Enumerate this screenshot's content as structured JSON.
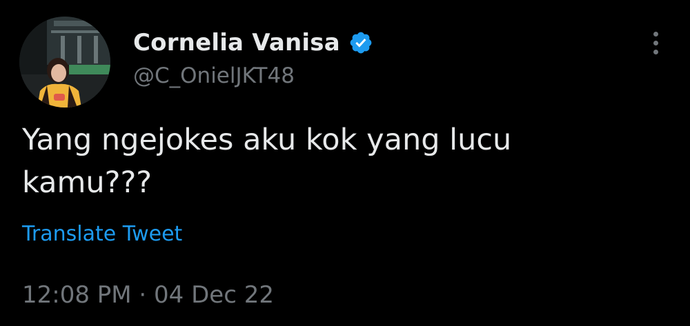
{
  "author": {
    "display_name": "Cornelia Vanisa",
    "handle": "@C_OnielJKT48",
    "verified": true,
    "verified_icon": "verified-badge-icon",
    "avatar_icon": "profile-photo"
  },
  "tweet": {
    "text": "Yang ngejokes aku kok yang lucu\nkamu???",
    "translate_label": "Translate Tweet",
    "timestamp": "12:08 PM · 04 Dec 22"
  },
  "menu": {
    "more_icon": "more-vertical-icon"
  },
  "colors": {
    "background": "#000000",
    "primary_text": "#e7e9ea",
    "secondary_text": "#71767b",
    "accent": "#1d9bf0"
  }
}
